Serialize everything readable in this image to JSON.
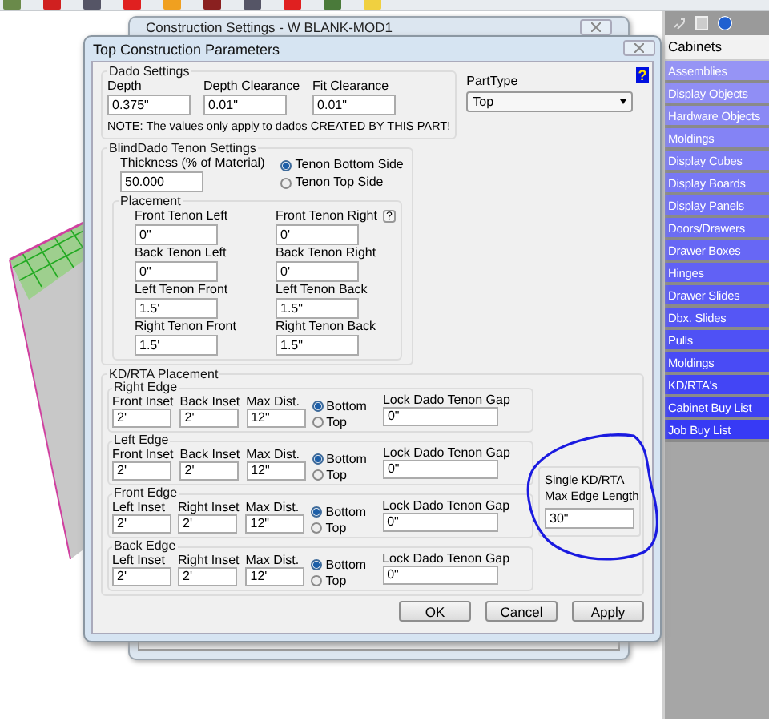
{
  "back_window": {
    "title": "Construction Settings - W BLANK-MOD1"
  },
  "dialog": {
    "title": "Top Construction Parameters",
    "dado_settings": {
      "title": "Dado Settings",
      "fields": [
        {
          "label": "Depth",
          "value": "0.375\""
        },
        {
          "label": "Depth Clearance",
          "value": "0.01\""
        },
        {
          "label": "Fit Clearance",
          "value": "0.01\""
        }
      ],
      "note": "NOTE: The values only apply to dados CREATED BY THIS PART!"
    },
    "part_type": {
      "label": "PartType",
      "value": "Top"
    },
    "help": "?",
    "tenon": {
      "title": "BlindDado Tenon Settings",
      "thickness_label": "Thickness (% of Material)",
      "thickness": "50.000",
      "options": [
        {
          "label": "Tenon Bottom Side",
          "selected": true
        },
        {
          "label": "Tenon Top Side",
          "selected": false
        }
      ],
      "placement": {
        "title": "Placement",
        "help": "?",
        "fields": [
          {
            "label": "Front Tenon Left",
            "value": "0\""
          },
          {
            "label": "Front Tenon Right",
            "value": "0'"
          },
          {
            "label": "Back Tenon Left",
            "value": "0\""
          },
          {
            "label": "Back Tenon Right",
            "value": "0'"
          },
          {
            "label": "Left Tenon Front",
            "value": "1.5'"
          },
          {
            "label": "Left Tenon Back",
            "value": "1.5\""
          },
          {
            "label": "Right Tenon Front",
            "value": "1.5'"
          },
          {
            "label": "Right Tenon Back",
            "value": "1.5\""
          }
        ]
      }
    },
    "kd_rta": {
      "title": "KD/RTA Placement",
      "edges": [
        {
          "title": "Right Edge",
          "fields": [
            {
              "label": "Front Inset",
              "value": "2'"
            },
            {
              "label": "Back Inset",
              "value": "2'"
            },
            {
              "label": "Max Dist.",
              "value": "12\""
            }
          ],
          "options": [
            {
              "label": "Bottom",
              "selected": true
            },
            {
              "label": "Top",
              "selected": false
            }
          ],
          "lock_label": "Lock Dado Tenon Gap",
          "lock_value": "0\""
        },
        {
          "title": "Left Edge",
          "fields": [
            {
              "label": "Front Inset",
              "value": "2'"
            },
            {
              "label": "Back Inset",
              "value": "2'"
            },
            {
              "label": "Max Dist.",
              "value": "12\""
            }
          ],
          "options": [
            {
              "label": "Bottom",
              "selected": true
            },
            {
              "label": "Top",
              "selected": false
            }
          ],
          "lock_label": "Lock Dado Tenon Gap",
          "lock_value": "0\""
        },
        {
          "title": "Front Edge",
          "fields": [
            {
              "label": "Left Inset",
              "value": "2'"
            },
            {
              "label": "Right Inset",
              "value": "2'"
            },
            {
              "label": "Max Dist.",
              "value": "12\""
            }
          ],
          "options": [
            {
              "label": "Bottom",
              "selected": true
            },
            {
              "label": "Top",
              "selected": false
            }
          ],
          "lock_label": "Lock Dado Tenon Gap",
          "lock_value": "0\""
        },
        {
          "title": "Back Edge",
          "fields": [
            {
              "label": "Left Inset",
              "value": "2'"
            },
            {
              "label": "Right Inset",
              "value": "2'"
            },
            {
              "label": "Max Dist.",
              "value": "12'"
            }
          ],
          "options": [
            {
              "label": "Bottom",
              "selected": true
            },
            {
              "label": "Top",
              "selected": false
            }
          ],
          "lock_label": "Lock Dado Tenon Gap",
          "lock_value": "0\""
        }
      ],
      "single": {
        "label_lines": [
          "Single KD/RTA",
          "Max Edge Length"
        ],
        "value": "30\""
      }
    },
    "buttons": [
      "OK",
      "Cancel",
      "Apply"
    ]
  },
  "sidebar": {
    "tabs": [
      {
        "label": "Cabinets",
        "selected": true
      }
    ],
    "items": [
      "Assemblies",
      "Display Objects",
      "Hardware Objects",
      "Moldings",
      "Display Cubes",
      "Display Boards",
      "Display Panels",
      "Doors/Drawers",
      "Drawer Boxes",
      "Hinges",
      "Drawer Slides",
      "Dbx. Slides",
      "Pulls",
      "Moldings",
      "KD/RTA's",
      "Cabinet Buy List",
      "Job Buy List"
    ]
  }
}
